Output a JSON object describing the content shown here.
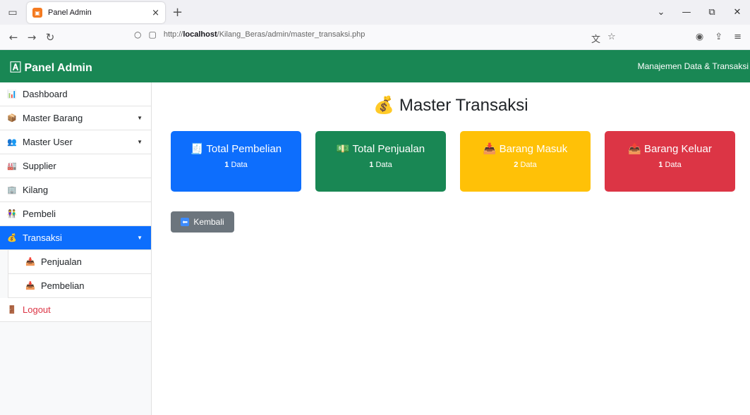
{
  "browser": {
    "tab_title": "Panel Admin",
    "tab_close": "×",
    "new_tab": "+",
    "url_prefix": "http://",
    "url_host": "localhost",
    "url_path": "/Kilang_Beras/admin/master_transaksi.php"
  },
  "header": {
    "brand": "🄰 Panel Admin",
    "subtitle": "Manajemen Data & Transaksi"
  },
  "sidebar": {
    "items": [
      {
        "label": "Dashboard",
        "icon": "📊"
      },
      {
        "label": "Master Barang",
        "icon": "📦"
      },
      {
        "label": "Master User",
        "icon": "👥"
      },
      {
        "label": "Supplier",
        "icon": "🏭"
      },
      {
        "label": "Kilang",
        "icon": "🏢"
      },
      {
        "label": "Pembeli",
        "icon": "👫"
      },
      {
        "label": "Transaksi",
        "icon": "💰"
      },
      {
        "label": "Penjualan",
        "icon": "📥"
      },
      {
        "label": "Pembelian",
        "icon": "📥"
      },
      {
        "label": "Logout",
        "icon": "🚪"
      }
    ]
  },
  "main": {
    "title": "Master Transaksi",
    "title_icon": "💰",
    "cards": [
      {
        "label": "Total Pembelian",
        "icon": "🧾",
        "count": "1",
        "unit": " Data",
        "color": "#0d6efd"
      },
      {
        "label": "Total Penjualan",
        "icon": "💵",
        "count": "1",
        "unit": " Data",
        "color": "#198754"
      },
      {
        "label": "Barang Masuk",
        "icon": "📥",
        "count": "2",
        "unit": " Data",
        "color": "#ffc107"
      },
      {
        "label": "Barang Keluar",
        "icon": "📤",
        "count": "1",
        "unit": " Data",
        "color": "#dc3545"
      }
    ],
    "back_label": "Kembali"
  }
}
